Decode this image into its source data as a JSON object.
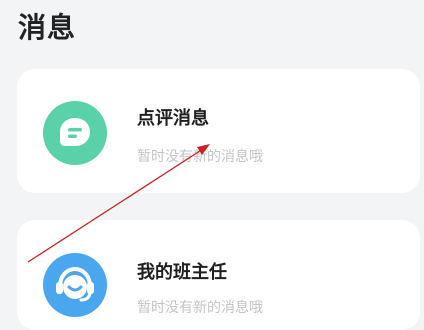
{
  "page": {
    "title": "消息"
  },
  "cards": [
    {
      "title": "点评消息",
      "subtitle": "暂时没有新的消息哦",
      "icon": "comment-bubble-icon",
      "color": "#5bd1a9"
    },
    {
      "title": "我的班主任",
      "subtitle": "暂时没有新的消息哦",
      "icon": "headset-avatar-icon",
      "color": "#4aa7ef"
    }
  ],
  "colors": {
    "background": "#f3f4f6",
    "card": "#ffffff",
    "title_text": "#222222",
    "subtitle_text": "#c2c4c8",
    "annotation_arrow": "#cc2222"
  }
}
